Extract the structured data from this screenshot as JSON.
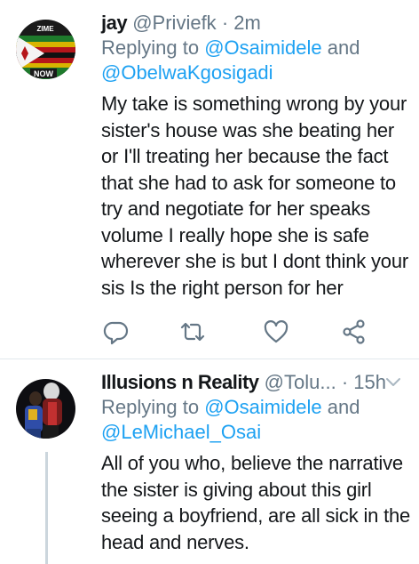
{
  "tweets": [
    {
      "name": "jay",
      "handle": "@Priviefk",
      "separator": "·",
      "time": "2m",
      "replying_to_prefix": "Replying to",
      "mentions": [
        "@Osaimidele",
        "@ObelwaKgosigadi"
      ],
      "mentions_joiner": "and",
      "avatar_text_top": "ZIME",
      "avatar_text_bottom": "NOW",
      "body_lines": [
        "My take is something wrong by your",
        "sister's house was she beating her",
        "or I'll treating her because the fact",
        "that she had to ask for someone to",
        "try and negotiate for her speaks",
        "volume I really hope she is safe",
        "wherever she is but I dont think your",
        "sis Is the right person for her"
      ],
      "actions": [
        "reply-icon",
        "retweet-icon",
        "like-icon",
        "share-icon"
      ]
    },
    {
      "name": "Illusions n Reality",
      "handle": "@Tolu...",
      "separator": "·",
      "time": "15h",
      "replying_to_prefix": "Replying to",
      "mentions": [
        "@Osaimidele",
        "@LeMichael_Osai"
      ],
      "mentions_joiner": "and",
      "body_lines": [
        "All of you who, believe the narrative",
        "the sister is giving about this girl",
        "seeing a boyfriend, are all sick in the",
        "head and nerves."
      ]
    }
  ],
  "colors": {
    "text": "#14171a",
    "secondary": "#657786",
    "link": "#1da1f2",
    "divider": "#e1e8ed",
    "thread_line": "#ccd6dd"
  }
}
